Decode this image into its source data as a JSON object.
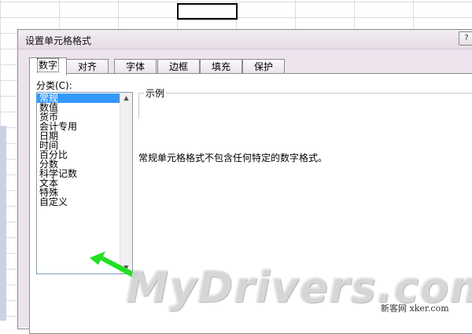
{
  "dialog": {
    "title": "设置单元格格式",
    "help_icon": "?"
  },
  "tabs": [
    {
      "label": "数字",
      "active": true
    },
    {
      "label": "对齐"
    },
    {
      "label": "字体"
    },
    {
      "label": "边框"
    },
    {
      "label": "填充"
    },
    {
      "label": "保护"
    }
  ],
  "category": {
    "label": "分类(C):",
    "items": [
      "常规",
      "数值",
      "货币",
      "会计专用",
      "日期",
      "时间",
      "百分比",
      "分数",
      "科学记数",
      "文本",
      "特殊",
      "自定义"
    ],
    "selected": "常规"
  },
  "sample": {
    "label": "示例",
    "value": ""
  },
  "description": "常规单元格格式不包含任何特定的数字格式。",
  "watermark": "MyDrivers.com",
  "credit": "新客网 xker.com",
  "colors": {
    "selection": "#3399ff",
    "arrow": "#22e022",
    "dialog_bg": "#ece3ec"
  }
}
